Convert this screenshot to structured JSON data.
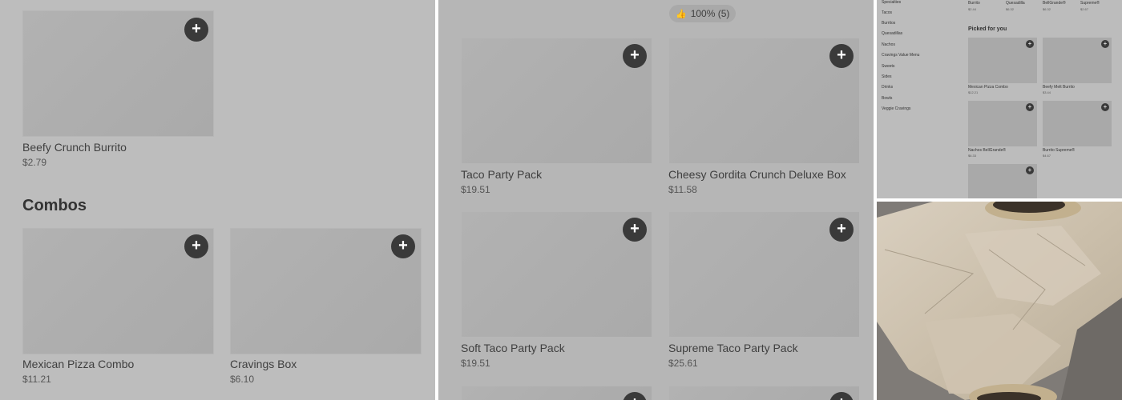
{
  "panel_a": {
    "top_item": {
      "name": "Beefy Crunch Burrito",
      "price": "$2.79"
    },
    "section_title": "Combos",
    "combos": [
      {
        "name": "Mexican Pizza Combo",
        "price": "$11.21"
      },
      {
        "name": "Cravings Box",
        "price": "$6.10"
      }
    ]
  },
  "panel_b": {
    "rating_badge": "100% (5)",
    "items": [
      {
        "name": "Taco Party Pack",
        "price": "$19.51"
      },
      {
        "name": "Cheesy Gordita Crunch Deluxe Box",
        "price": "$11.58"
      },
      {
        "name": "Soft Taco Party Pack",
        "price": "$19.51"
      },
      {
        "name": "Supreme Taco Party Pack",
        "price": "$25.61"
      }
    ]
  },
  "panel_c": {
    "categories": [
      "Specialties",
      "Tacos",
      "Burritos",
      "Quesadillas",
      "Nachos",
      "Cravings Value Menu",
      "Sweets",
      "Sides",
      "Drinks",
      "Bowls",
      "Veggie Cravings"
    ],
    "top_strip": [
      {
        "name": "Burrito",
        "price": "$2.44"
      },
      {
        "name": "Quesadilla",
        "price": "$6.32"
      },
      {
        "name": "BellGrande®",
        "price": "$6.32"
      },
      {
        "name": "Supreme®",
        "price": "$2.67"
      }
    ],
    "section_title": "Picked for you",
    "picked": [
      {
        "name": "Mexican Pizza Combo",
        "price": "$12.21"
      },
      {
        "name": "Beefy Melt Burrito",
        "price": "$3.44"
      },
      {
        "name": "Nachos BellGrande®",
        "price": "$6.33"
      },
      {
        "name": "Burrito Supreme®",
        "price": "$4.67"
      }
    ]
  },
  "icons": {
    "add": "+",
    "thumbs_up": "👍"
  }
}
